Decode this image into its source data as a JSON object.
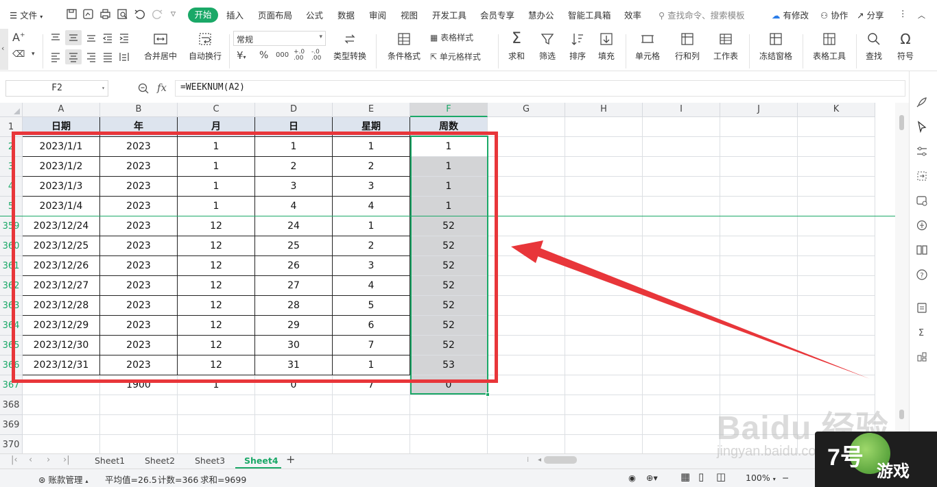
{
  "menubar": {
    "file_label": "文件",
    "tabs": [
      "开始",
      "插入",
      "页面布局",
      "公式",
      "数据",
      "审阅",
      "视图",
      "开发工具",
      "会员专享",
      "慧办公",
      "智能工具箱",
      "效率"
    ],
    "search_placeholder": "查找命令、搜索模板",
    "modify_label": "有修改",
    "collab_label": "协作",
    "share_label": "分享"
  },
  "ribbon": {
    "merge_center": "合并居中",
    "wrap_text": "自动换行",
    "number_format": "常规",
    "type_convert": "类型转换",
    "cond_format": "条件格式",
    "table_style": "表格样式",
    "cell_style": "单元格样式",
    "sum": "求和",
    "filter": "筛选",
    "sort": "排序",
    "fill": "填充",
    "cell": "单元格",
    "row_col": "行和列",
    "worksheet": "工作表",
    "freeze": "冻结窗格",
    "table_tools": "表格工具",
    "find": "查找",
    "symbol": "符号",
    "currency_symbol": "¥",
    "percent_symbol": "%",
    "thousands_symbol": "000",
    "dec_inc": "+.0 .00",
    "dec_dec": "-.0 .00"
  },
  "formula_bar": {
    "name_box": "F2",
    "fx_label": "fx",
    "formula": "=WEEKNUM(A2)"
  },
  "grid": {
    "columns": [
      "A",
      "B",
      "C",
      "D",
      "E",
      "F",
      "G",
      "H",
      "I",
      "J",
      "K"
    ],
    "header_row": {
      "row_label": "1",
      "cells": [
        "日期",
        "年",
        "月",
        "日",
        "星期",
        "周数"
      ]
    },
    "rows": [
      {
        "row_label": "2",
        "cells": [
          "2023/1/1",
          "2023",
          "1",
          "1",
          "1",
          "1"
        ]
      },
      {
        "row_label": "3",
        "cells": [
          "2023/1/2",
          "2023",
          "1",
          "2",
          "2",
          "1"
        ]
      },
      {
        "row_label": "4",
        "cells": [
          "2023/1/3",
          "2023",
          "1",
          "3",
          "3",
          "1"
        ]
      },
      {
        "row_label": "5",
        "cells": [
          "2023/1/4",
          "2023",
          "1",
          "4",
          "4",
          "1"
        ]
      },
      {
        "row_label": "359",
        "cells": [
          "2023/12/24",
          "2023",
          "12",
          "24",
          "1",
          "52"
        ]
      },
      {
        "row_label": "360",
        "cells": [
          "2023/12/25",
          "2023",
          "12",
          "25",
          "2",
          "52"
        ]
      },
      {
        "row_label": "361",
        "cells": [
          "2023/12/26",
          "2023",
          "12",
          "26",
          "3",
          "52"
        ]
      },
      {
        "row_label": "362",
        "cells": [
          "2023/12/27",
          "2023",
          "12",
          "27",
          "4",
          "52"
        ]
      },
      {
        "row_label": "363",
        "cells": [
          "2023/12/28",
          "2023",
          "12",
          "28",
          "5",
          "52"
        ]
      },
      {
        "row_label": "364",
        "cells": [
          "2023/12/29",
          "2023",
          "12",
          "29",
          "6",
          "52"
        ]
      },
      {
        "row_label": "365",
        "cells": [
          "2023/12/30",
          "2023",
          "12",
          "30",
          "7",
          "52"
        ]
      },
      {
        "row_label": "366",
        "cells": [
          "2023/12/31",
          "2023",
          "12",
          "31",
          "1",
          "53"
        ]
      },
      {
        "row_label": "367",
        "cells": [
          "",
          "1900",
          "1",
          "0",
          "7",
          "0"
        ]
      },
      {
        "row_label": "368",
        "cells": [
          "",
          "",
          "",
          "",
          "",
          ""
        ]
      },
      {
        "row_label": "369",
        "cells": [
          "",
          "",
          "",
          "",
          "",
          ""
        ]
      },
      {
        "row_label": "370",
        "cells": [
          "",
          "",
          "",
          "",
          "",
          ""
        ]
      }
    ]
  },
  "sheets": {
    "tabs": [
      "Sheet1",
      "Sheet2",
      "Sheet3",
      "Sheet4"
    ],
    "active": "Sheet4",
    "add_label": "+"
  },
  "status": {
    "account_label": "账款管理",
    "average": "平均值=26.5",
    "count": "计数=366",
    "sum": "求和=9699",
    "zoom": "100%"
  },
  "watermark": {
    "baidu": "Baidu 经验",
    "jingyan": "jingyan.baidu.com",
    "logo_num": "7号",
    "logo_txt": "游戏"
  },
  "colors": {
    "accent": "#1aa867",
    "annotation": "#e8363a",
    "selected_fill": "#d3d4d6"
  }
}
